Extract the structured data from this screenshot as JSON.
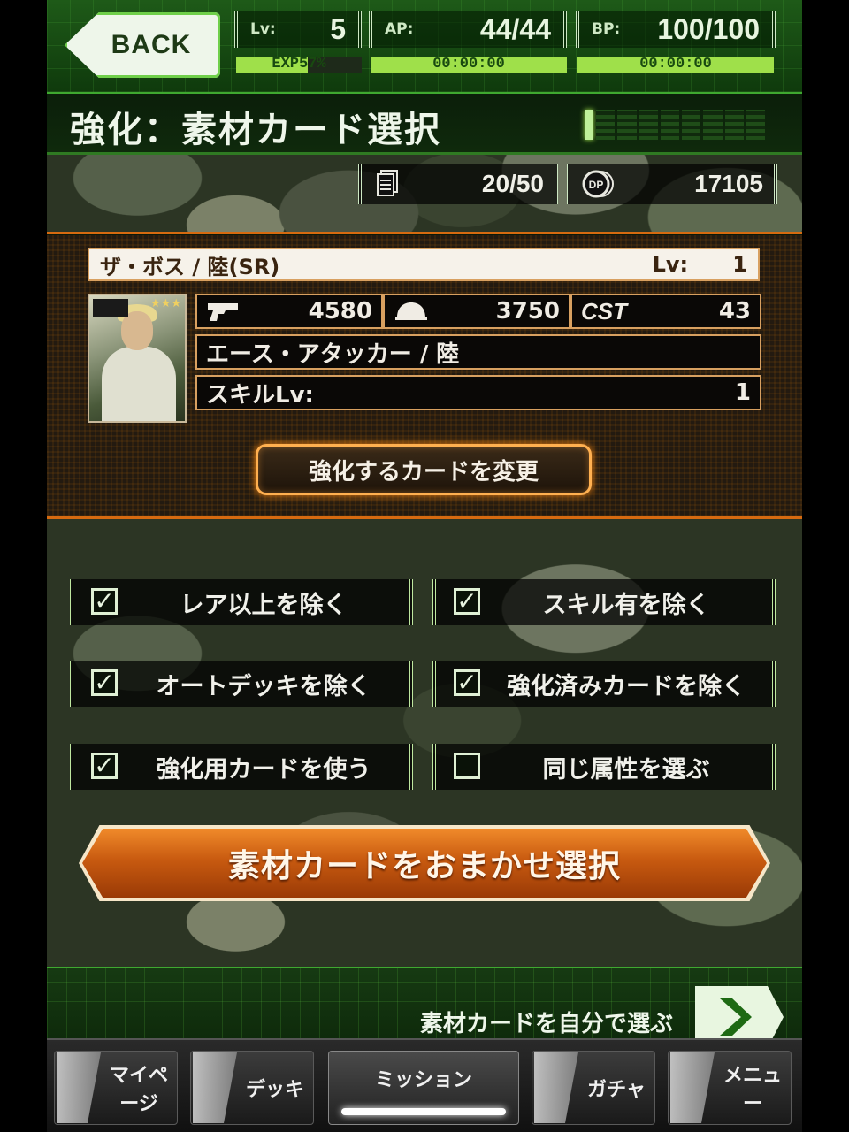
{
  "header": {
    "back_label": "BACK",
    "lv_label": "Lv:",
    "lv_value": "5",
    "ap_label": "AP:",
    "ap_value": "44/44",
    "bp_label": "BP:",
    "bp_value": "100/100",
    "exp_text": "EXP57%",
    "exp_percent": 57,
    "ap_timer": "00:00:00",
    "bp_timer": "00:00:00"
  },
  "title": {
    "text": "強化：素材カード選択",
    "progress_step": 1,
    "progress_total": 9
  },
  "resources": {
    "cards": "20/50",
    "dp_icon_text": "DP",
    "dp": "17105"
  },
  "card": {
    "name": "ザ・ボス / 陸(SR)",
    "lv_label": "Lv:",
    "lv_value": "1",
    "attack": "4580",
    "defense": "3750",
    "cost_label": "CST",
    "cost": "43",
    "type": "エース・アタッカー / 陸",
    "skill_label": "スキルLv:",
    "skill_value": "1",
    "stars": "★★★",
    "change_button": "強化するカードを変更"
  },
  "filters": [
    {
      "label": "レア以上を除く",
      "checked": true
    },
    {
      "label": "スキル有を除く",
      "checked": true
    },
    {
      "label": "オートデッキを除く",
      "checked": true
    },
    {
      "label": "強化済みカードを除く",
      "checked": true
    },
    {
      "label": "強化用カードを使う",
      "checked": true
    },
    {
      "label": "同じ属性を選ぶ",
      "checked": false
    }
  ],
  "check_glyph": "✓",
  "auto_select_button": "素材カードをおまかせ選択",
  "self_select_label": "素材カードを自分で選ぶ",
  "nav": {
    "items": [
      "マイページ",
      "デッキ",
      "ミッション",
      "ガチャ",
      "メニュー"
    ],
    "active": "ミッション"
  },
  "colors": {
    "accent_green": "#9fe04a",
    "accent_orange": "#d66a10",
    "button_orange": "#c85a10"
  }
}
